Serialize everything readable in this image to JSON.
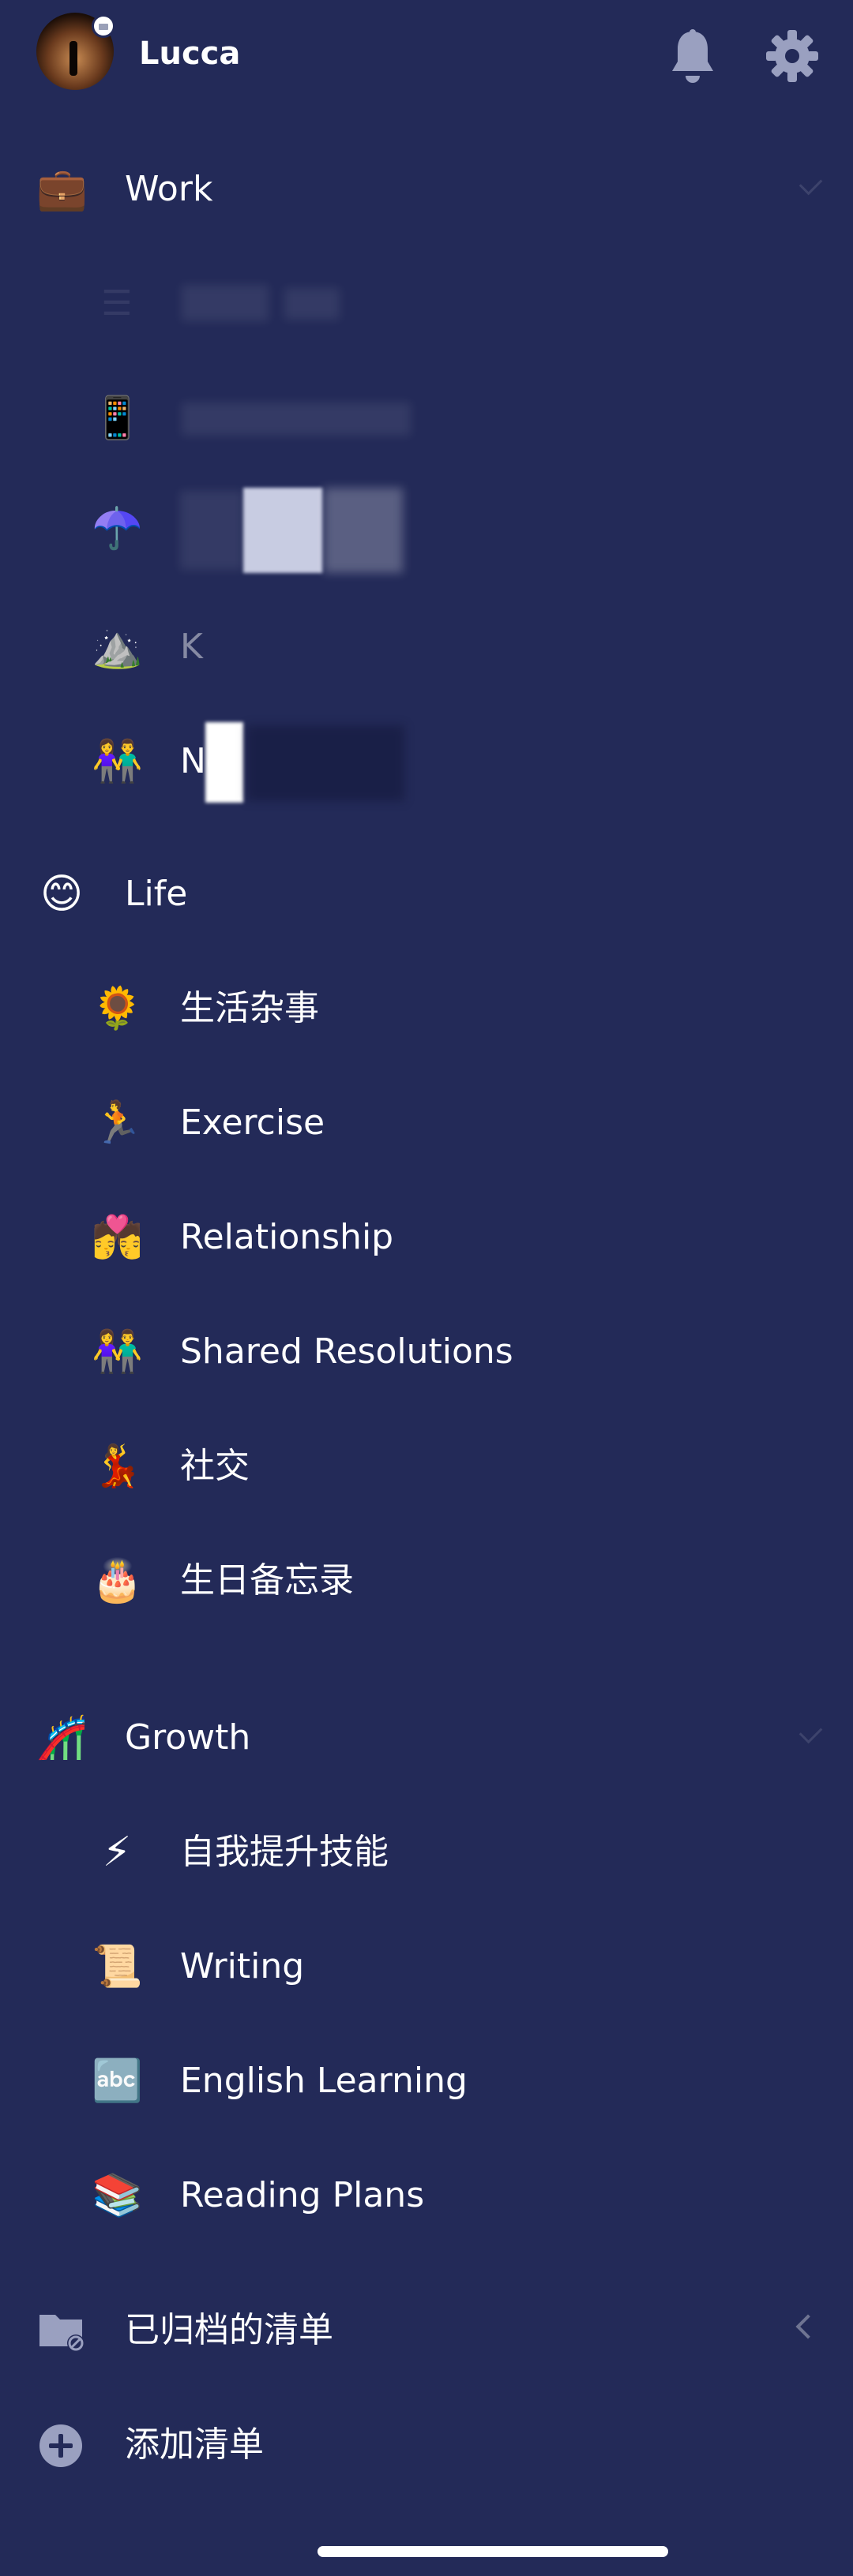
{
  "header": {
    "username": "Lucca",
    "bell_icon": "bell-icon",
    "settings_icon": "gear-icon"
  },
  "groups": [
    {
      "id": "work",
      "icon": "💼",
      "label": "Work",
      "items": [
        {
          "icon": "☰",
          "label": ""
        },
        {
          "icon": "📱",
          "label": ""
        },
        {
          "icon": "☂️",
          "label": ""
        },
        {
          "icon": "⛰️",
          "label": "K"
        },
        {
          "icon": "👫",
          "label": "Ne"
        }
      ]
    },
    {
      "id": "life",
      "icon": "😊",
      "label": "Life",
      "items": [
        {
          "icon": "🌻",
          "label": "生活杂事"
        },
        {
          "icon": "🏃",
          "label": "Exercise"
        },
        {
          "icon": "💏",
          "label": "Relationship"
        },
        {
          "icon": "👫",
          "label": "Shared Resolutions"
        },
        {
          "icon": "💃",
          "label": "社交"
        },
        {
          "icon": "🎂",
          "label": "生日备忘录"
        }
      ]
    },
    {
      "id": "growth",
      "icon": "🎢",
      "label": "Growth",
      "items": [
        {
          "icon": "⚡",
          "label": "自我提升技能"
        },
        {
          "icon": "📜",
          "label": "Writing"
        },
        {
          "icon": "🔤",
          "label": "English Learning"
        },
        {
          "icon": "📚",
          "label": "Reading Plans"
        }
      ]
    }
  ],
  "footer": {
    "archived_label": "已归档的清单",
    "add_list_label": "添加清单"
  },
  "colors": {
    "background": "#232a58",
    "text": "#ffffff",
    "icon_gray": "#9aa0c0"
  }
}
